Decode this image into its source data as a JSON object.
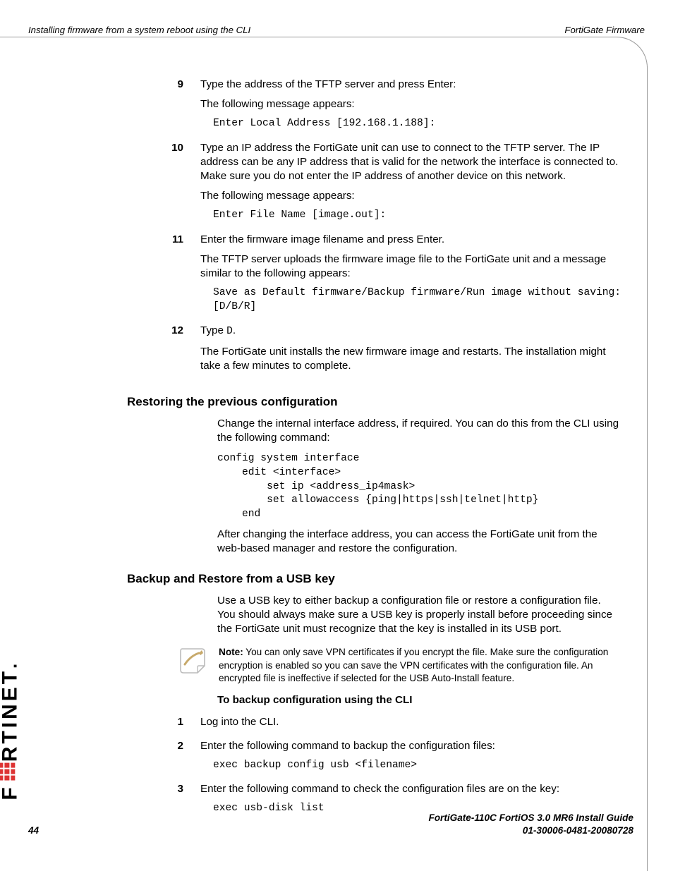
{
  "header": {
    "left": "Installing firmware from a system reboot using the CLI",
    "right": "FortiGate Firmware"
  },
  "steps_a": [
    {
      "num": "9",
      "paras": [
        "Type the address of the TFTP server and press Enter:",
        "The following message appears:"
      ],
      "code": "Enter Local Address [192.168.1.188]:"
    },
    {
      "num": "10",
      "paras": [
        "Type an IP address the FortiGate unit can use to connect to the TFTP server. The IP address can be any IP address that is valid for the network the interface is connected to. Make sure you do not enter the IP address of another device on this network.",
        "The following message appears:"
      ],
      "code": "Enter File Name [image.out]:"
    },
    {
      "num": "11",
      "paras": [
        "Enter the firmware image filename and press Enter.",
        "The TFTP server uploads the firmware image file to the FortiGate unit and a message similar to the following appears:"
      ],
      "code": "Save as Default firmware/Backup firmware/Run image without saving: [D/B/R]"
    }
  ],
  "step12": {
    "num": "12",
    "pre": "Type ",
    "code_inline": "D",
    "post": ".",
    "para2": "The FortiGate unit installs the new firmware image and restarts. The installation might take a few minutes to complete."
  },
  "restore": {
    "heading": "Restoring the previous configuration",
    "p1": "Change the internal interface address, if required. You can do this from the CLI using the following command:",
    "code": "config system interface\n    edit <interface>\n        set ip <address_ip4mask>\n        set allowaccess {ping|https|ssh|telnet|http}\n    end",
    "p2": "After changing the interface address, you can access the FortiGate unit from the web-based manager and restore the configuration."
  },
  "usb": {
    "heading": "Backup and Restore from a USB key",
    "p1": "Use a USB key to either backup a configuration file or restore a configuration file. You should always make sure a USB key is properly install before proceeding since the FortiGate unit must recognize that the key is installed in its USB port.",
    "note_label": "Note:",
    "note_text": " You can only save VPN certificates if you encrypt the file. Make sure the configuration encryption is enabled so you can save the VPN certificates with the configuration file. An encrypted file is ineffective if selected for the USB Auto-Install feature.",
    "subhead": "To backup configuration using the CLI",
    "steps": [
      {
        "num": "1",
        "text": "Log into the CLI."
      },
      {
        "num": "2",
        "text": "Enter the following command to backup the configuration files:",
        "code": "exec backup config usb <filename>"
      },
      {
        "num": "3",
        "text": "Enter the following command to check the configuration files are on the key:",
        "code": "exec usb-disk list"
      }
    ]
  },
  "footer": {
    "page": "44",
    "r1": "FortiGate-110C FortiOS 3.0 MR6 Install Guide",
    "r2": "01-30006-0481-20080728"
  },
  "logo_text": "F",
  "logo_text2": "RTINET"
}
